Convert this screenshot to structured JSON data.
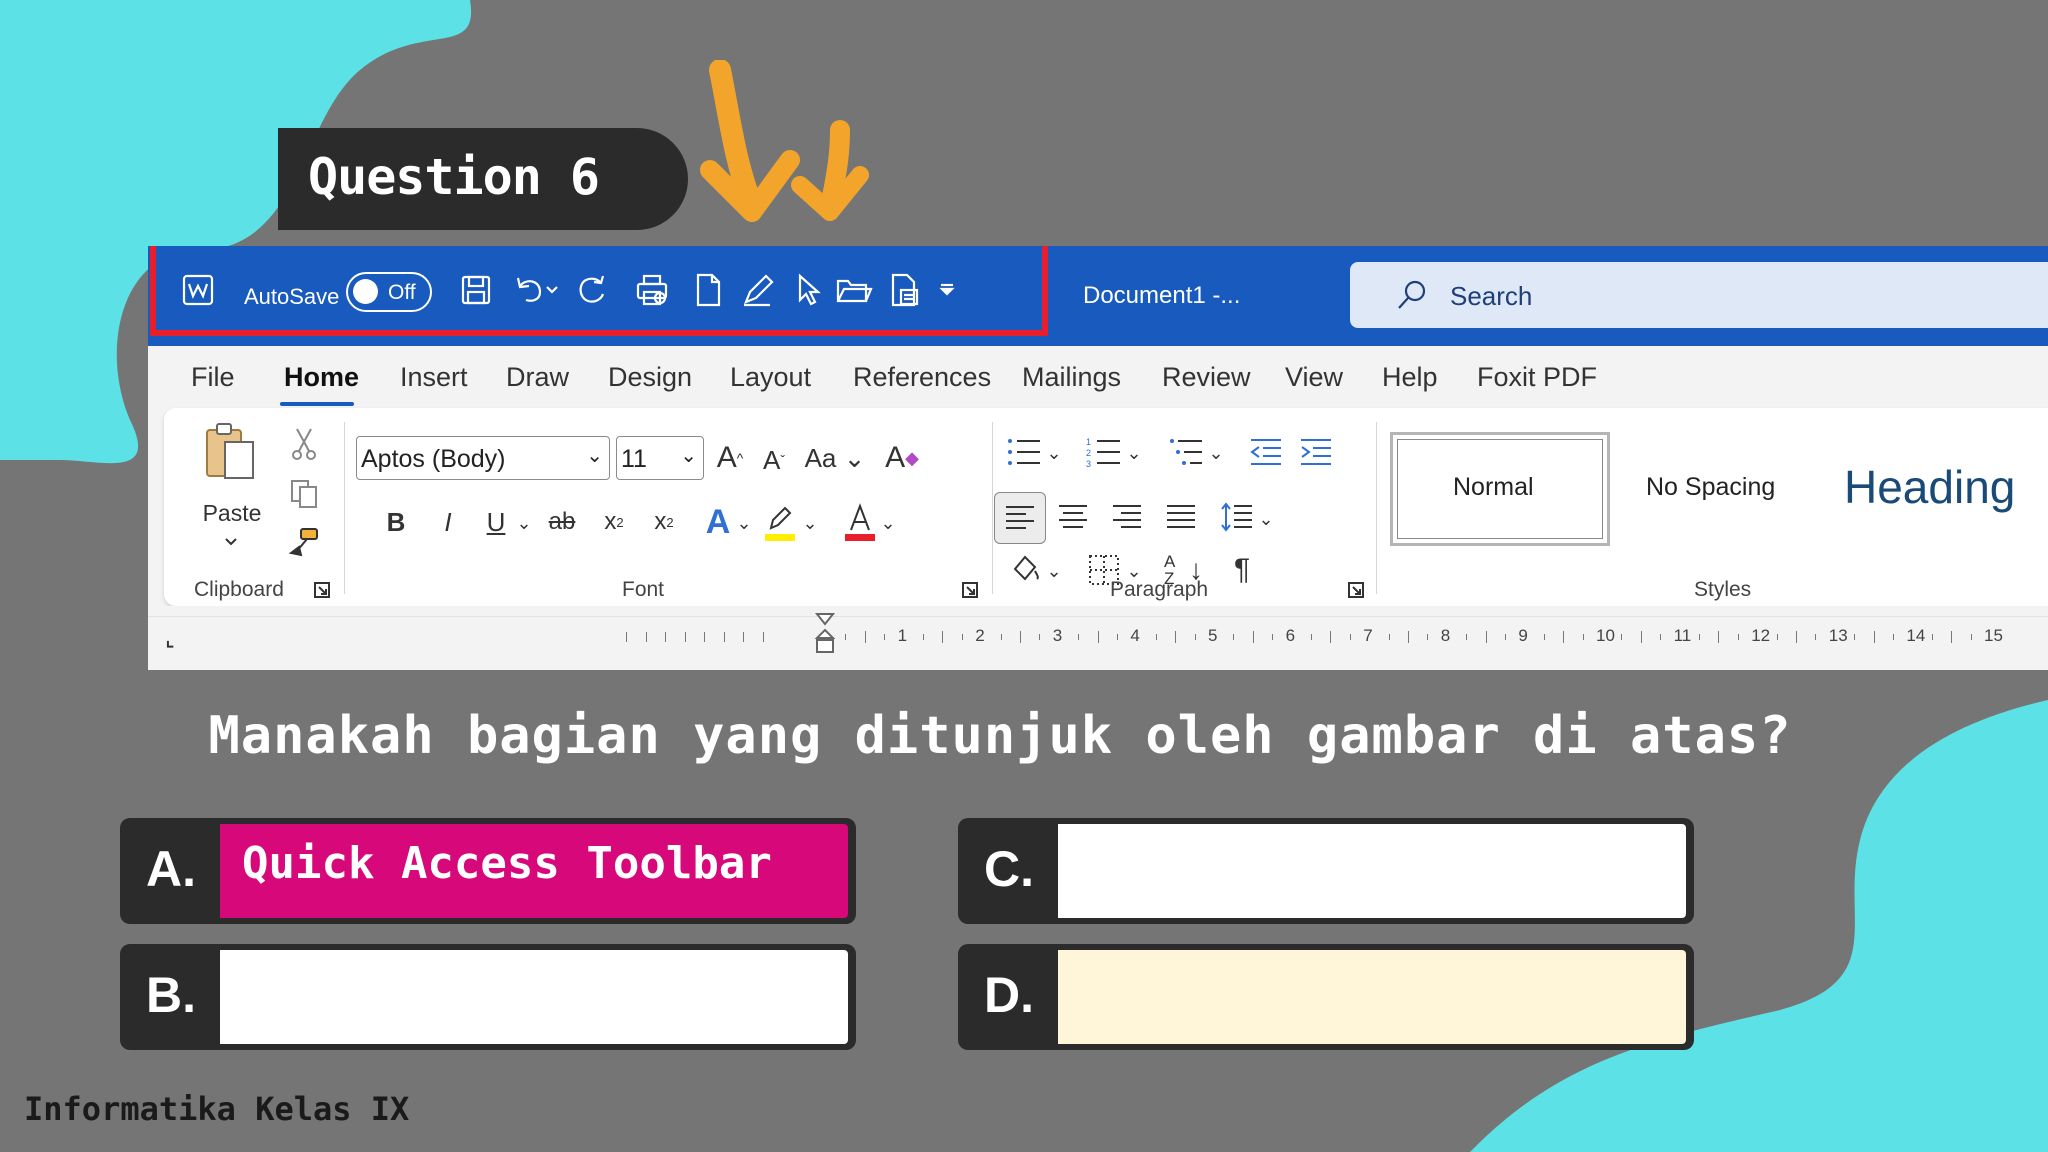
{
  "question_label": "Question 6",
  "qat": {
    "autosave_label": "AutoSave",
    "autosave_state": "Off",
    "doc_title": "Document1  -...",
    "search_label": "Search"
  },
  "tabs": [
    "File",
    "Home",
    "Insert",
    "Draw",
    "Design",
    "Layout",
    "References",
    "Mailings",
    "Review",
    "View",
    "Help",
    "Foxit PDF"
  ],
  "ribbon": {
    "paste_label": "Paste",
    "groups": {
      "clipboard": "Clipboard",
      "font": "Font",
      "paragraph": "Paragraph",
      "styles": "Styles"
    },
    "font_name": "Aptos (Body)",
    "font_size": "11",
    "styles": [
      "Normal",
      "No Spacing",
      "Heading"
    ]
  },
  "ruler_numbers": [
    "1",
    "2",
    "3",
    "4",
    "5",
    "6",
    "7",
    "8",
    "9",
    "10",
    "11",
    "12",
    "13",
    "14",
    "15"
  ],
  "question_text": "Manakah bagian yang ditunjuk oleh gambar di atas?",
  "answers": [
    {
      "letter": "A.",
      "text": "Quick Access Toolbar",
      "color": "#d6087a"
    },
    {
      "letter": "B.",
      "text": "",
      "color": "#ffffff"
    },
    {
      "letter": "C.",
      "text": "",
      "color": "#ffffff"
    },
    {
      "letter": "D.",
      "text": "",
      "color": "#fff5d9"
    }
  ],
  "footer": "Informatika Kelas IX",
  "colors": {
    "background": "#757575",
    "blob": "#5ce1e6",
    "word_blue": "#185abd",
    "highlight": "#e81e2a",
    "arrow": "#f2a52a",
    "dark": "#2b2b2b"
  }
}
